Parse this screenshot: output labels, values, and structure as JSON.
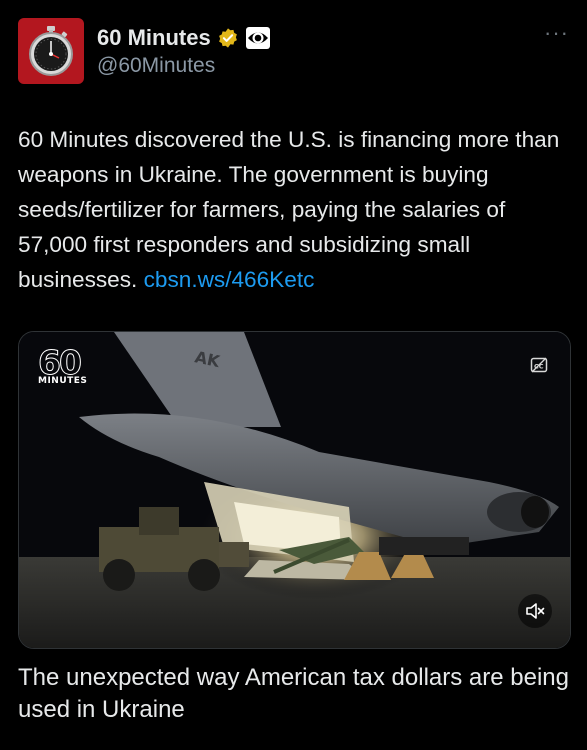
{
  "author": {
    "display_name": "60 Minutes",
    "handle": "@60Minutes",
    "verified_badge_color": "#e2b719"
  },
  "menu": {
    "more_label": "···"
  },
  "tweet": {
    "text": "60 Minutes discovered the U.S. is financing more than weapons in Ukraine. The government is buying seeds/fertilizer for farmers, paying the salaries of 57,000 first responders and subsidizing small businesses. ",
    "link": "cbsn.ws/466Ketc"
  },
  "media": {
    "logo_number": "60",
    "logo_word": "MINUTES",
    "tail_code": "AK",
    "icons": [
      "closed-captions-icon",
      "mute-icon"
    ]
  },
  "card": {
    "caption": "The unexpected way American tax dollars are being used in Ukraine"
  },
  "colors": {
    "background": "#000000",
    "text": "#e7e9ea",
    "secondary": "#8b98a5",
    "link": "#1d9bf0",
    "avatar": "#b3171f"
  }
}
